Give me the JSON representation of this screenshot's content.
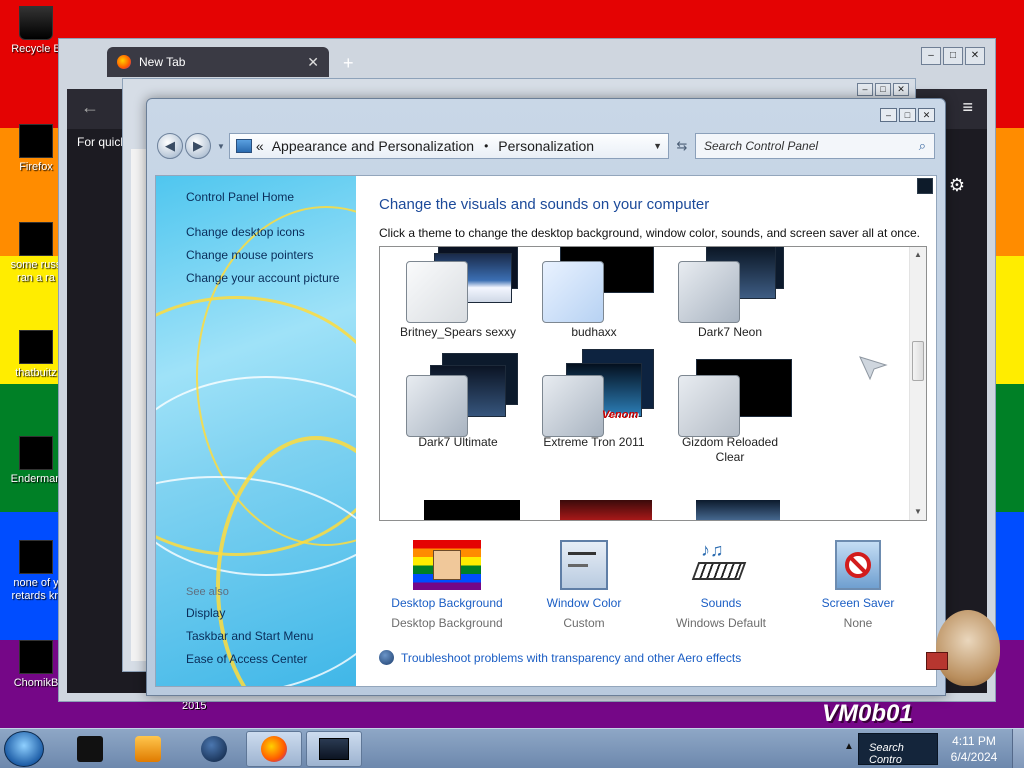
{
  "desktop": {
    "icons": [
      {
        "label": "Recycle B",
        "name": "desktop-icon-recycle-bin"
      },
      {
        "label": "Firefox",
        "name": "desktop-icon-firefox"
      },
      {
        "label": "some russ\nran a ra",
        "name": "desktop-icon-some-russ"
      },
      {
        "label": "thatbuitz",
        "name": "desktop-icon-thatbuitz"
      },
      {
        "label": "Enderman",
        "name": "desktop-icon-enderman"
      },
      {
        "label": "none of y\nretards kn",
        "name": "desktop-icon-none-of-y"
      },
      {
        "label": "ChomikB",
        "name": "desktop-icon-chomikb"
      }
    ],
    "wallpaper_text": "VM0b01",
    "wallpaper_number": "2015",
    "colors": {
      "red": "#e40303",
      "orange": "#ff8c00",
      "yellow": "#ffed00",
      "green": "#008026",
      "blue": "#004dff",
      "purple": "#750787"
    }
  },
  "browser": {
    "tab_title": "New Tab",
    "quick_text": "For quick"
  },
  "control_panel": {
    "breadcrumb": [
      "Appearance and Personalization",
      "Personalization"
    ],
    "breadcrumb_prefix": "«",
    "search_placeholder": "Search Control Panel",
    "sidebar": {
      "home": "Control Panel Home",
      "tasks": [
        "Change desktop icons",
        "Change mouse pointers",
        "Change your account picture"
      ],
      "see_also_heading": "See also",
      "see_also": [
        "Display",
        "Taskbar and Start Menu",
        "Ease of Access Center"
      ]
    },
    "title": "Change the visuals and sounds on your computer",
    "subtitle": "Click a theme to change the desktop background, window color, sounds, and screen saver all at once.",
    "themes": [
      {
        "name": "Britney_Spears sexxy"
      },
      {
        "name": "budhaxx"
      },
      {
        "name": "Dark7 Neon"
      },
      {
        "name": "Dark7 Ultimate"
      },
      {
        "name": "Extreme Tron 2011"
      },
      {
        "name": "Gizdom Reloaded Clear"
      }
    ],
    "tron_overlay": "Venom",
    "bottom": [
      {
        "link": "Desktop Background",
        "value": "Desktop Background"
      },
      {
        "link": "Window Color",
        "value": "Custom"
      },
      {
        "link": "Sounds",
        "value": "Windows Default"
      },
      {
        "link": "Screen Saver",
        "value": "None"
      }
    ],
    "troubleshoot": "Troubleshoot problems with transparency and other Aero effects"
  },
  "taskbar": {
    "tray_text": "Search Contro",
    "time": "4:11 PM",
    "date": "6/4/2024"
  }
}
